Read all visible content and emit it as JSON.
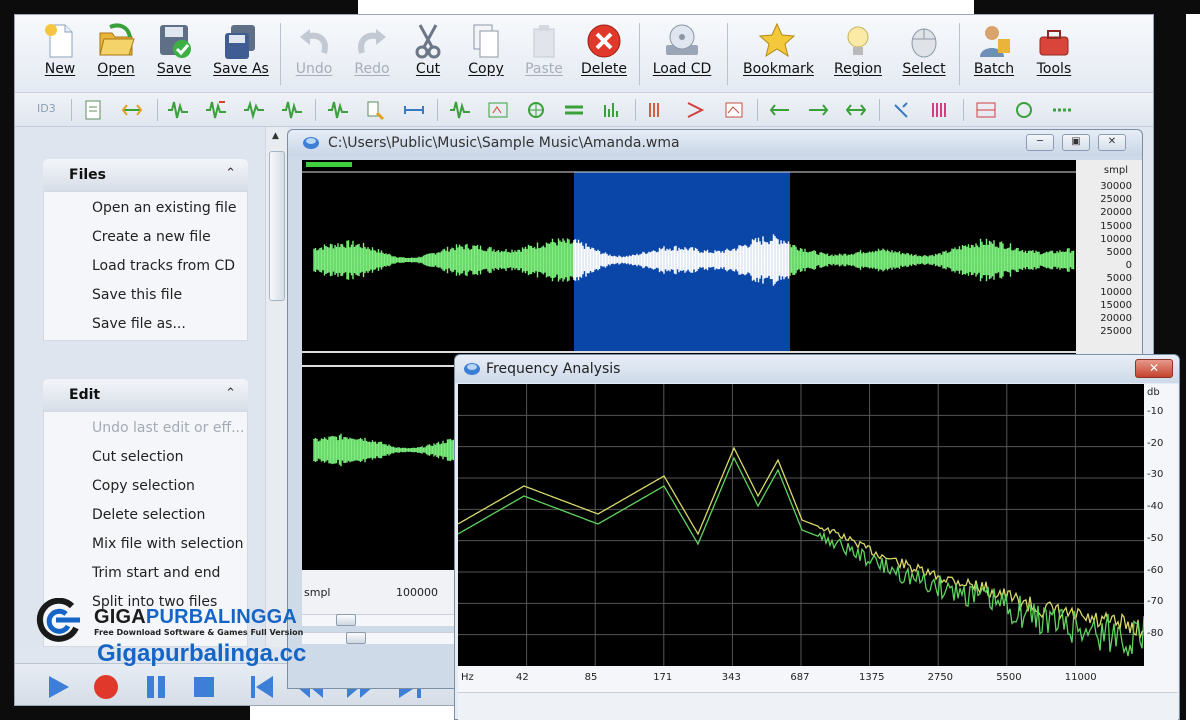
{
  "toolbar": {
    "buttons": [
      {
        "label": "New",
        "icon": "new-file-icon",
        "enabled": true
      },
      {
        "label": "Open",
        "icon": "open-folder-icon",
        "enabled": true
      },
      {
        "label": "Save",
        "icon": "save-disk-icon",
        "enabled": true
      },
      {
        "label": "Save As",
        "icon": "save-as-disk-icon",
        "enabled": true
      },
      {
        "label": "Undo",
        "icon": "undo-icon",
        "enabled": false
      },
      {
        "label": "Redo",
        "icon": "redo-icon",
        "enabled": false
      },
      {
        "label": "Cut",
        "icon": "scissors-icon",
        "enabled": true
      },
      {
        "label": "Copy",
        "icon": "copy-icon",
        "enabled": true
      },
      {
        "label": "Paste",
        "icon": "paste-icon",
        "enabled": false
      },
      {
        "label": "Delete",
        "icon": "delete-icon",
        "enabled": true
      },
      {
        "label": "Load CD",
        "icon": "cd-icon",
        "enabled": true
      },
      {
        "label": "Bookmark",
        "icon": "star-icon",
        "enabled": true
      },
      {
        "label": "Region",
        "icon": "bulb-icon",
        "enabled": true
      },
      {
        "label": "Select",
        "icon": "mouse-icon",
        "enabled": true
      },
      {
        "label": "Batch",
        "icon": "batch-user-icon",
        "enabled": true
      },
      {
        "label": "Tools",
        "icon": "toolbox-icon",
        "enabled": true
      }
    ],
    "id3_label": "ID3"
  },
  "taskpane": {
    "files": {
      "title": "Files",
      "items": [
        {
          "label": "Open an existing file",
          "enabled": true
        },
        {
          "label": "Create a new file",
          "enabled": true
        },
        {
          "label": "Load tracks from CD",
          "enabled": true
        },
        {
          "label": "Save this file",
          "enabled": true
        },
        {
          "label": "Save file as...",
          "enabled": true
        }
      ]
    },
    "edit": {
      "title": "Edit",
      "items": [
        {
          "label": "Undo last edit or eff...",
          "enabled": false
        },
        {
          "label": "Cut selection",
          "enabled": true
        },
        {
          "label": "Copy selection",
          "enabled": true
        },
        {
          "label": "Delete selection",
          "enabled": true
        },
        {
          "label": "Mix file with selection",
          "enabled": true
        },
        {
          "label": "Trim start and end",
          "enabled": true
        },
        {
          "label": "Split into two files",
          "enabled": true
        }
      ]
    }
  },
  "logo": {
    "name_part1": "GIGA",
    "name_part2": "PURBALINGGA",
    "tagline": "Free Download Software & Games Full Version",
    "url": "Gigapurbalinga.cc"
  },
  "wave_window": {
    "title": "C:\\Users\\Public\\Music\\Sample Music\\Amanda.wma",
    "scale_unit": "smpl",
    "scale_labels": [
      "30000",
      "25000",
      "20000",
      "15000",
      "10000",
      "5000",
      "0",
      "5000",
      "10000",
      "15000",
      "20000",
      "25000"
    ],
    "time_unit": "smpl",
    "time_label": "100000",
    "colors": {
      "wave": "#7cf07c",
      "selected_wave": "#ffffff",
      "selection": "#0a46a8",
      "background": "#000000"
    }
  },
  "freq_window": {
    "title": "Frequency Analysis",
    "close_label": "✕",
    "db_unit": "db",
    "db_labels": [
      "-10",
      "-20",
      "-30",
      "-40",
      "-50",
      "-60",
      "-70",
      "-80"
    ],
    "hz_unit": "Hz",
    "hz_labels": [
      "42",
      "85",
      "171",
      "343",
      "687",
      "1375",
      "2750",
      "5500",
      "11000"
    ],
    "colors": {
      "series_a": "#d8d86a",
      "series_b": "#5fd35f",
      "grid": "#555555"
    }
  },
  "transport": {
    "buttons": [
      "play-icon",
      "record-icon",
      "pause-icon",
      "stop-icon",
      "go-start-icon",
      "rewind-icon",
      "fast-forward-icon",
      "go-end-icon"
    ]
  }
}
